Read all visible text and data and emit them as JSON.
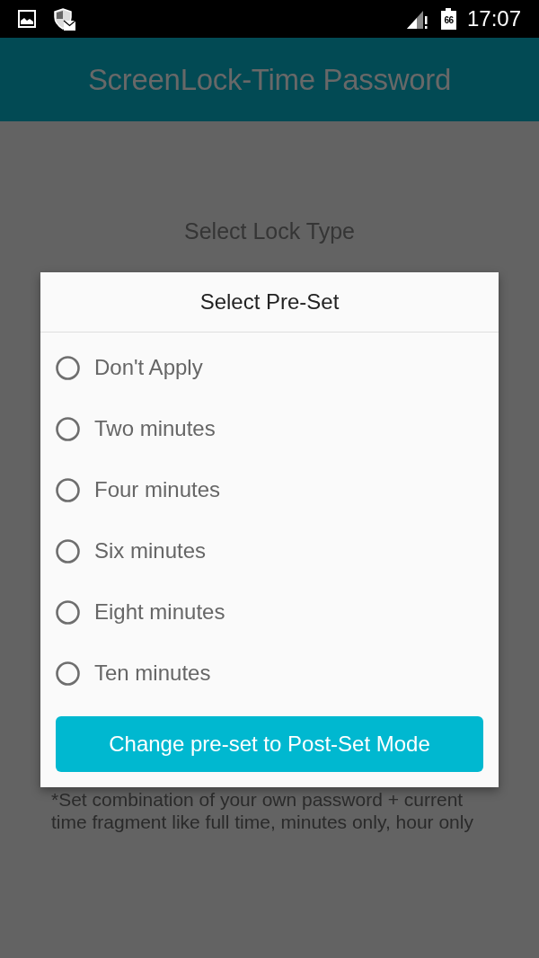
{
  "status_bar": {
    "battery_label": "66",
    "time": "17:07"
  },
  "app_bar": {
    "title": "ScreenLock-Time Password"
  },
  "page": {
    "heading": "Select Lock Type",
    "note_lines": [
      "*Set combination of your own password + current",
      "time fragment like full time, minutes only, hour only"
    ]
  },
  "dialog": {
    "title": "Select Pre-Set",
    "options": [
      {
        "label": "Don't Apply",
        "selected": false
      },
      {
        "label": "Two minutes",
        "selected": false
      },
      {
        "label": "Four minutes",
        "selected": false
      },
      {
        "label": "Six minutes",
        "selected": false
      },
      {
        "label": "Eight minutes",
        "selected": false
      },
      {
        "label": "Ten minutes",
        "selected": false
      }
    ],
    "button": "Change pre-set to Post-Set Mode"
  }
}
